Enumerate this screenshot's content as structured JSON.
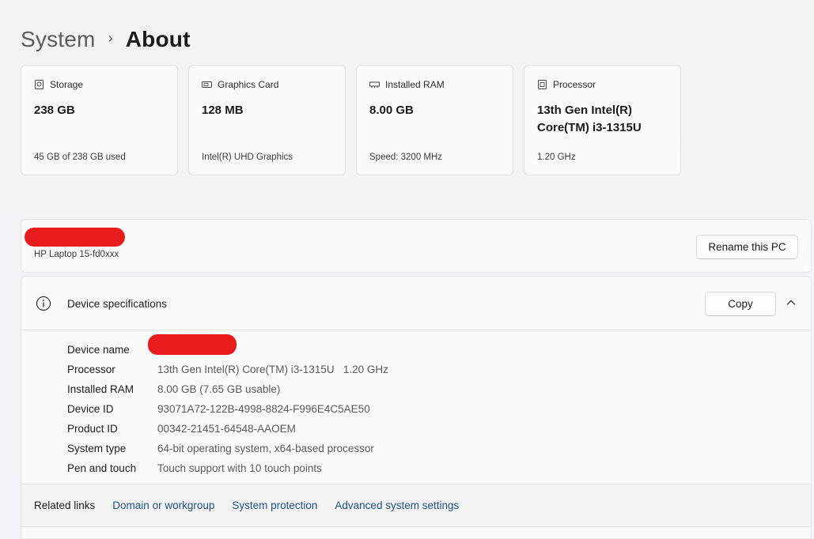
{
  "breadcrumb": {
    "parent": "System",
    "separator": "›",
    "current": "About"
  },
  "cards": [
    {
      "icon": "storage-icon",
      "title": "Storage",
      "value": "238 GB",
      "sub": "45 GB of 238 GB used"
    },
    {
      "icon": "graphics-card-icon",
      "title": "Graphics Card",
      "value": "128 MB",
      "sub": "Intel(R) UHD Graphics"
    },
    {
      "icon": "ram-icon",
      "title": "Installed RAM",
      "value": "8.00 GB",
      "sub": "Speed: 3200 MHz"
    },
    {
      "icon": "processor-icon",
      "title": "Processor",
      "value": "13th Gen Intel(R) Core(TM) i3-1315U",
      "sub": "1.20 GHz"
    }
  ],
  "pc": {
    "model": "HP Laptop 15-fd0xxx",
    "rename_label": "Rename this PC"
  },
  "specs": {
    "title": "Device specifications",
    "copy_label": "Copy",
    "rows": [
      {
        "label": "Device name",
        "value": ""
      },
      {
        "label": "Processor",
        "value": "13th Gen Intel(R) Core(TM) i3-1315U   1.20 GHz"
      },
      {
        "label": "Installed RAM",
        "value": "8.00 GB (7.65 GB usable)"
      },
      {
        "label": "Device ID",
        "value": "93071A72-122B-4998-8824-F996E4C5AE50"
      },
      {
        "label": "Product ID",
        "value": "00342-21451-64548-AAOEM"
      },
      {
        "label": "System type",
        "value": "64-bit operating system, x64-based processor"
      },
      {
        "label": "Pen and touch",
        "value": "Touch support with 10 touch points"
      }
    ]
  },
  "related": {
    "label": "Related links",
    "links": [
      "Domain or workgroup",
      "System protection",
      "Advanced system settings"
    ]
  },
  "colors": {
    "link": "#1f4e8c",
    "redaction": "#e81c1c"
  }
}
